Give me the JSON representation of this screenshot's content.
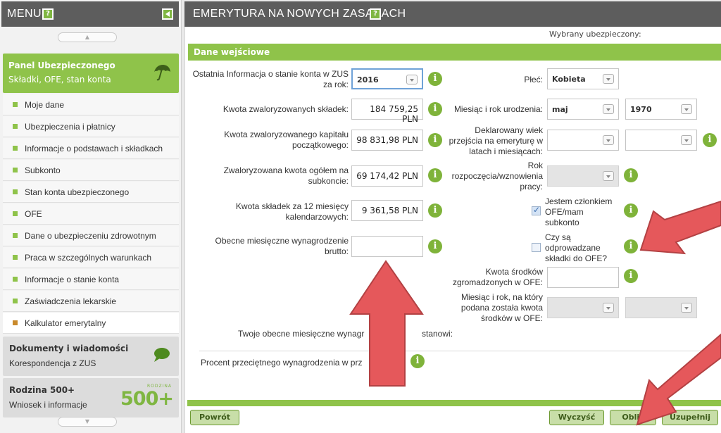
{
  "sidebar": {
    "header_title": "MENU",
    "help_label": "?",
    "panel": {
      "title": "Panel Ubezpieczonego",
      "subtitle": "Składki, OFE, stan konta"
    },
    "items": [
      {
        "label": "Moje dane"
      },
      {
        "label": "Ubezpieczenia i płatnicy"
      },
      {
        "label": "Informacje o podstawach i składkach"
      },
      {
        "label": "Subkonto"
      },
      {
        "label": "Stan konta ubezpieczonego"
      },
      {
        "label": "OFE"
      },
      {
        "label": "Dane o ubezpieczeniu zdrowotnym"
      },
      {
        "label": "Praca w szczególnych warunkach"
      },
      {
        "label": "Informacje o stanie konta"
      },
      {
        "label": "Zaświadczenia lekarskie"
      },
      {
        "label": "Kalkulator emerytalny"
      }
    ],
    "documents": {
      "title": "Dokumenty i wiadomości",
      "subtitle": "Korespondencja z ZUS"
    },
    "family": {
      "title": "Rodzina 500+",
      "subtitle": "Wniosek i informacje",
      "logo_small": "RODZINA",
      "logo_big": "500+"
    }
  },
  "main": {
    "header_title": "EMERYTURA NA NOWYCH ZASADACH",
    "help_label": "?",
    "selected_insured_label": "Wybrany ubezpieczony:",
    "section_title": "Dane wejściowe",
    "info_glyph": "i",
    "left_fields": {
      "last_info_label": "Ostatnia Informacja o stanie konta w ZUS za rok:",
      "last_info_value": "2016",
      "contributions_label": "Kwota zwaloryzowanych składek:",
      "contributions_value": "184 759,25 PLN",
      "initial_capital_label": "Kwota zwaloryzowanego kapitału początkowego:",
      "initial_capital_value": "98 831,98 PLN",
      "subaccount_label": "Zwaloryzowana kwota ogółem na subkoncie:",
      "subaccount_value": "69 174,42 PLN",
      "twelve_months_label": "Kwota składek za 12 miesięcy kalendarzowych:",
      "twelve_months_value": "9 361,58 PLN",
      "salary_label": "Obecne miesięczne wynagrodzenie brutto:",
      "salary_value": ""
    },
    "right_fields": {
      "gender_label": "Płeć:",
      "gender_value": "Kobieta",
      "birth_label": "Miesiąc i rok urodzenia:",
      "birth_month": "maj",
      "birth_year": "1970",
      "declared_age_label": "Deklarowany wiek przejścia na emeryturę w latach i miesiącach:",
      "start_year_label": "Rok rozpoczęcia/wznowienia pracy:",
      "ofe_member_label": "Jestem członkiem OFE/mam subkonto",
      "ofe_contrib_label": "Czy są odprowadzane składki do OFE?",
      "ofe_amount_label": "Kwota środków zgromadzonych w OFE:",
      "ofe_date_label": "Miesiąc i rok, na który podana została kwota środków w OFE:"
    },
    "current_salary_text": "Twoje obecne miesięczne wynagr",
    "current_salary_text_end": "stanowi:",
    "percent_text": "Procent przeciętnego wynagrodzenia w prz",
    "buttons": {
      "back": "Powrót",
      "clear": "Wyczyść",
      "calculate": "Oblic",
      "fill": "Uzupełnij"
    }
  }
}
